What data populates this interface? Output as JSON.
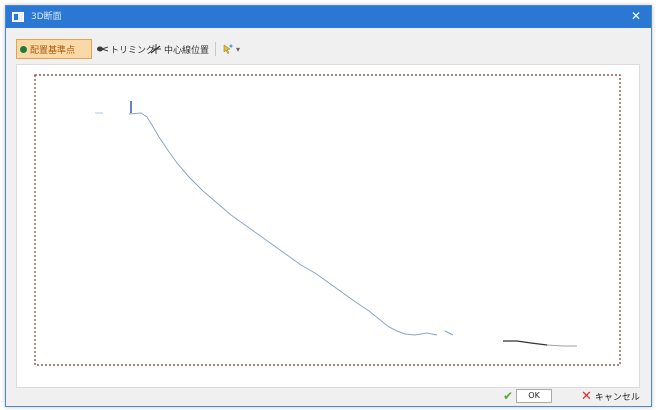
{
  "window": {
    "title": "3D断面",
    "close_glyph": "✕"
  },
  "toolbar": {
    "items": [
      {
        "label": "配置基準点",
        "icon": "point-icon",
        "active": true
      },
      {
        "label": "トリミング",
        "icon": "trim-icon",
        "active": false
      },
      {
        "label": "中心線位置",
        "icon": "centerline-icon",
        "active": false
      },
      {
        "label": "",
        "icon": "pointer-icon",
        "active": false
      }
    ],
    "dropdown_glyph": "▾"
  },
  "colors": {
    "titlebar": "#2b78d4",
    "active_tool_bg": "#fbd9a7",
    "profile_line": "#8aa3c8",
    "frame_dash": "#7a3b3b",
    "ok_check": "#5aa83a",
    "cancel_x": "#d83030"
  },
  "footer": {
    "ok_label": "OK",
    "cancel_label": "キャンセル"
  }
}
